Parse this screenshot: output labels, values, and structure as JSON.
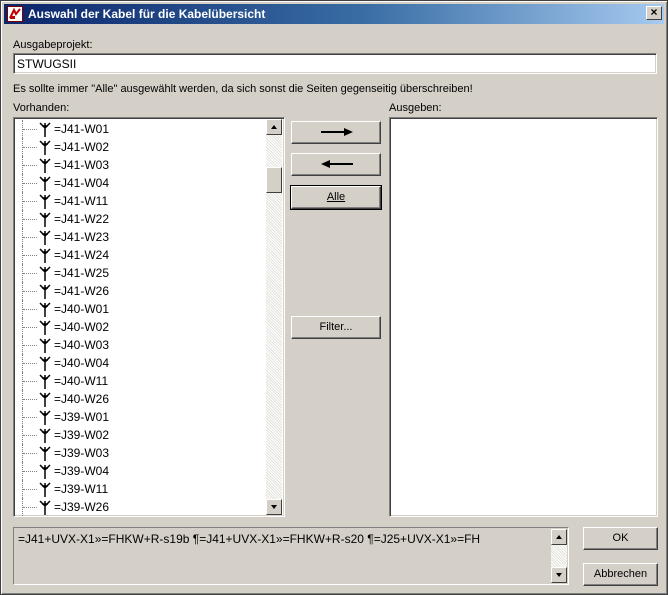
{
  "window": {
    "title": "Auswahl der Kabel für die Kabelübersicht",
    "close_glyph": "×"
  },
  "project": {
    "label": "Ausgabeprojekt:",
    "value": "STWUGSII"
  },
  "hint": "Es sollte immer \"Alle\" ausgewählt werden, da sich sonst die Seiten gegenseitig überschreiben!",
  "available": {
    "label": "Vorhanden:",
    "items": [
      "=J41-W01",
      "=J41-W02",
      "=J41-W03",
      "=J41-W04",
      "=J41-W11",
      "=J41-W22",
      "=J41-W23",
      "=J41-W24",
      "=J41-W25",
      "=J41-W26",
      "=J40-W01",
      "=J40-W02",
      "=J40-W03",
      "=J40-W04",
      "=J40-W11",
      "=J40-W26",
      "=J39-W01",
      "=J39-W02",
      "=J39-W03",
      "=J39-W04",
      "=J39-W11",
      "=J39-W26"
    ]
  },
  "output": {
    "label": "Ausgeben:",
    "items": []
  },
  "buttons": {
    "all": "Alle",
    "filter": "Filter...",
    "ok": "OK",
    "cancel": "Abbrechen"
  },
  "memo": {
    "text": "=J41+UVX-X1»=FHKW+R-s19b  ¶=J41+UVX-X1»=FHKW+R-s20  ¶=J25+UVX-X1»=FH"
  },
  "icons": {
    "add": "arrow-right-icon",
    "remove": "arrow-left-icon",
    "item": "cable-icon",
    "app": "app-icon"
  }
}
